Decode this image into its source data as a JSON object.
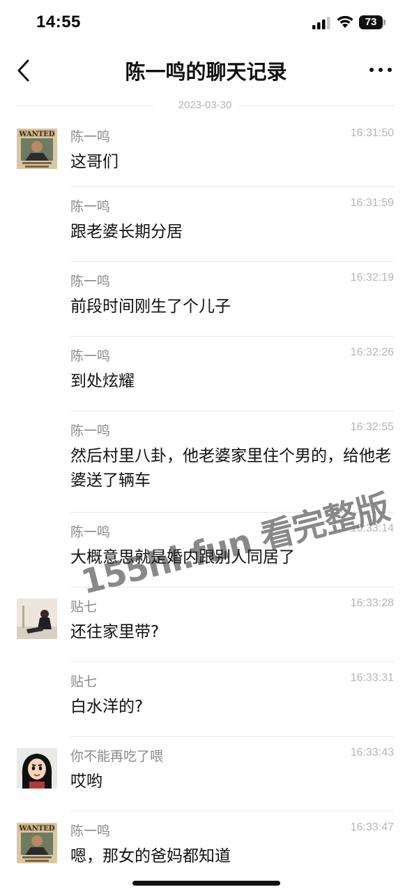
{
  "status_bar": {
    "time": "14:55",
    "battery": "73"
  },
  "header": {
    "title": "陈一鸣的聊天记录",
    "back_icon": "chevron-left-icon",
    "more_icon": "more-dots-icon"
  },
  "date_divider": "2023-03-30",
  "messages": [
    {
      "sender": "陈一鸣",
      "time": "16:31:50",
      "text": "这哥们",
      "avatar": "wanted-poster"
    },
    {
      "sender": "陈一鸣",
      "time": "16:31:59",
      "text": "跟老婆长期分居"
    },
    {
      "sender": "陈一鸣",
      "time": "16:32:19",
      "text": "前段时间刚生了个儿子"
    },
    {
      "sender": "陈一鸣",
      "time": "16:32:26",
      "text": "到处炫耀"
    },
    {
      "sender": "陈一鸣",
      "time": "16:32:55",
      "text": "然后村里八卦，他老婆家里住个男的，给他老婆送了辆车"
    },
    {
      "sender": "陈一鸣",
      "time": "16:33:14",
      "text": "大概意思就是婚内跟别人同居了"
    },
    {
      "sender": "贴七",
      "time": "16:33:28",
      "text": "还往家里带?",
      "avatar": "woman-photo"
    },
    {
      "sender": "贴七",
      "time": "16:33:31",
      "text": "白水洋的?"
    },
    {
      "sender": "你不能再吃了喂",
      "time": "16:33:43",
      "text": "哎哟",
      "avatar": "cartoon-character"
    },
    {
      "sender": "陈一鸣",
      "time": "16:33:47",
      "text": "嗯，那女的爸妈都知道",
      "avatar": "wanted-poster"
    }
  ],
  "watermark": "155hl.fun 看完整版",
  "colors": {
    "text_primary": "#111111",
    "text_secondary": "#8a8a8a",
    "timestamp": "#b5b5b5",
    "divider": "#e8e8e8"
  }
}
